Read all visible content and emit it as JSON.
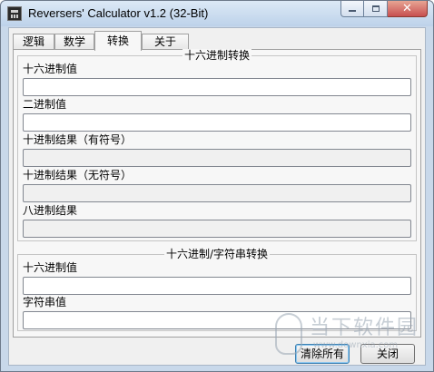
{
  "window": {
    "title": "Reversers' Calculator v1.2 (32-Bit)",
    "controls": {
      "minimize": "—",
      "maximize": "□",
      "close": "✕"
    }
  },
  "tabs": [
    {
      "label": "逻辑",
      "active": false
    },
    {
      "label": "数学",
      "active": false
    },
    {
      "label": "转换",
      "active": true
    },
    {
      "label": "关于",
      "active": false
    }
  ],
  "hex_conversion": {
    "title": "十六进制转换",
    "fields": [
      {
        "label": "十六进制值",
        "value": "",
        "editable": true
      },
      {
        "label": "二进制值",
        "value": "",
        "editable": true
      },
      {
        "label": "十进制结果（有符号）",
        "value": "",
        "editable": false
      },
      {
        "label": "十进制结果（无符号）",
        "value": "",
        "editable": false
      },
      {
        "label": "八进制结果",
        "value": "",
        "editable": false
      }
    ]
  },
  "string_conversion": {
    "title": "十六进制/字符串转换",
    "fields": [
      {
        "label": "十六进制值",
        "value": "",
        "editable": true
      },
      {
        "label": "字符串值",
        "value": "",
        "editable": true
      }
    ]
  },
  "buttons": {
    "clear_all": "清除所有",
    "close": "关闭"
  },
  "watermark": {
    "text": "当下软件园",
    "url": "www.downxia.com"
  }
}
